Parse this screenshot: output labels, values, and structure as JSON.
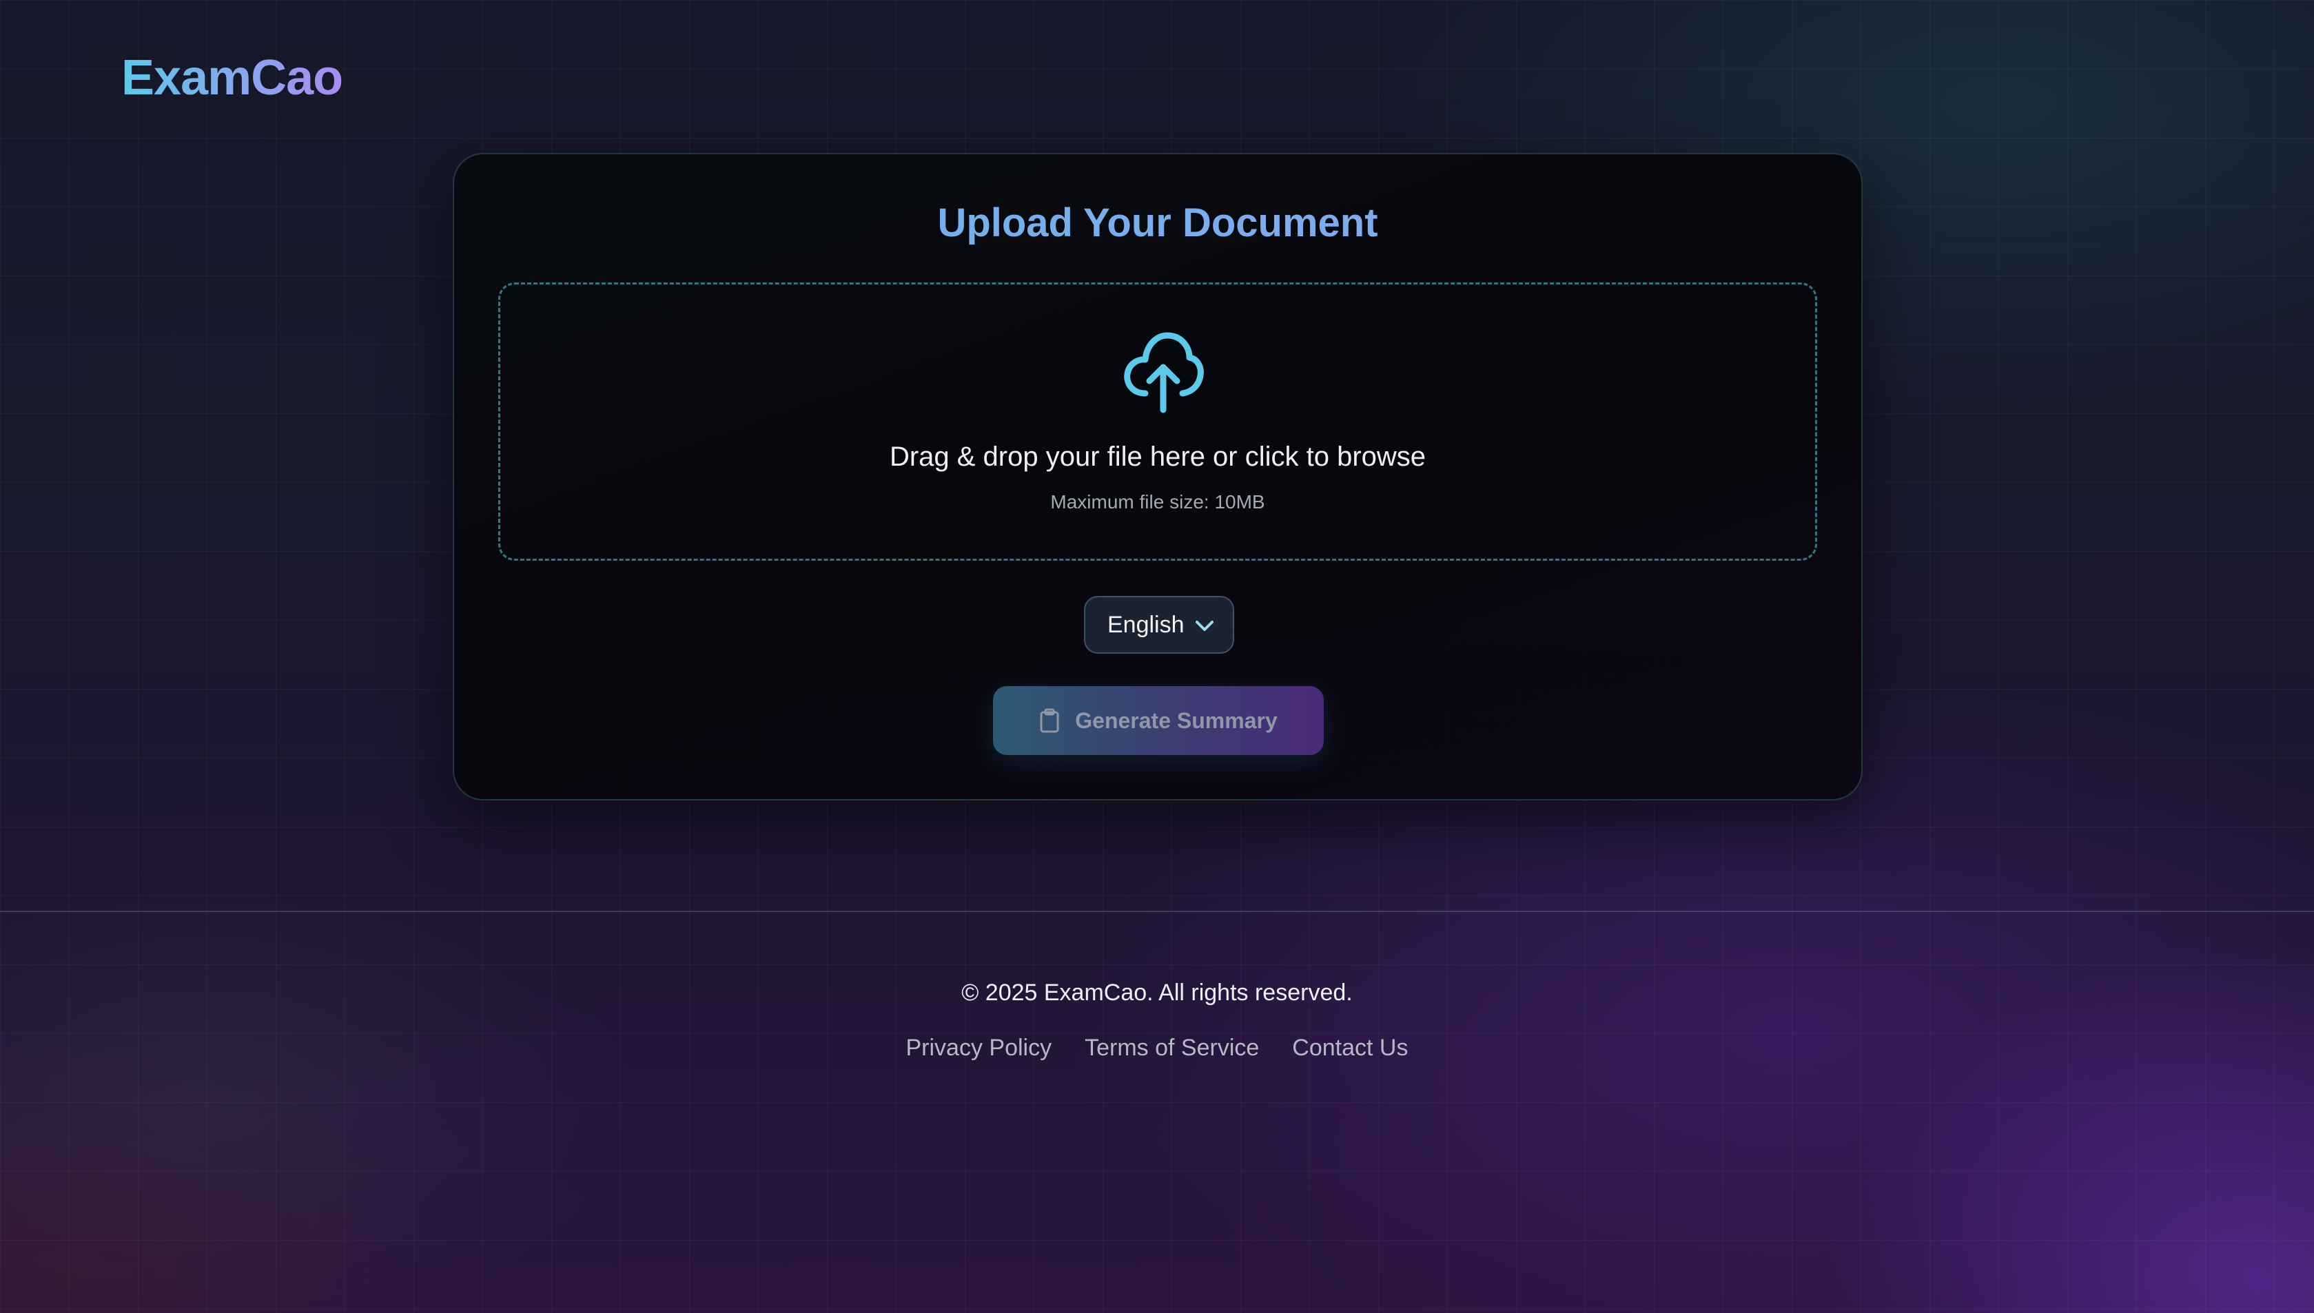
{
  "brand": {
    "logo_text": "ExamCao"
  },
  "upload": {
    "title": "Upload Your Document",
    "drop_text": "Drag & drop your file here or click to browse",
    "max_size_text": "Maximum file size: 10MB",
    "icon": "cloud-upload-icon"
  },
  "language": {
    "selected": "English",
    "icon": "chevron-down-icon"
  },
  "generate": {
    "label": "Generate Summary",
    "icon": "clipboard-icon",
    "state": "disabled"
  },
  "footer": {
    "copyright": "© 2025 ExamCao. All rights reserved.",
    "links": [
      "Privacy Policy",
      "Terms of Service",
      "Contact Us"
    ]
  },
  "colors": {
    "accent_cyan": "#5ec8e8",
    "accent_purple": "#a98cf0",
    "background_dark": "#15182a"
  }
}
